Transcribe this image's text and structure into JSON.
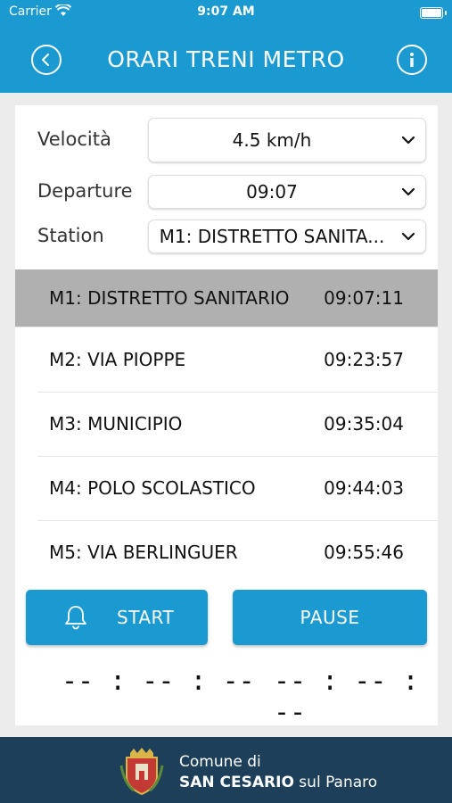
{
  "status_bar": {
    "carrier": "Carrier",
    "time": "9:07 AM"
  },
  "header": {
    "title": "ORARI TRENI METRO",
    "back_icon": "chevron-left-icon",
    "info_icon": "info-icon"
  },
  "form": {
    "speed_label": "Velocità",
    "speed_value": "4.5 km/h",
    "departure_label": "Departure",
    "departure_value": "09:07",
    "station_label": "Station",
    "station_value": "M1: DISTRETTO SANITA..."
  },
  "stations": [
    {
      "name": "M1: DISTRETTO SANITARIO",
      "time": "09:07:11",
      "selected": true
    },
    {
      "name": "M2: VIA PIOPPE",
      "time": "09:23:57"
    },
    {
      "name": "M3: MUNICIPIO",
      "time": "09:35:04"
    },
    {
      "name": "M4: POLO SCOLASTICO",
      "time": "09:44:03"
    },
    {
      "name": "M5: VIA BERLINGUER",
      "time": "09:55:46"
    }
  ],
  "buttons": {
    "start_label": "START",
    "pause_label": "PAUSE",
    "start_icon": "bell-icon"
  },
  "timers": {
    "left": "-- : -- : --",
    "right": "-- : -- : --"
  },
  "footer": {
    "line1": "Comune di",
    "line2_bold": "SAN CESARIO",
    "line2_rest": " sul Panaro",
    "logo": "municipal-crest-icon"
  },
  "colors": {
    "primary": "#1a9ad0",
    "footer": "#1d3f5a",
    "selected_row": "#b0b0b0"
  }
}
